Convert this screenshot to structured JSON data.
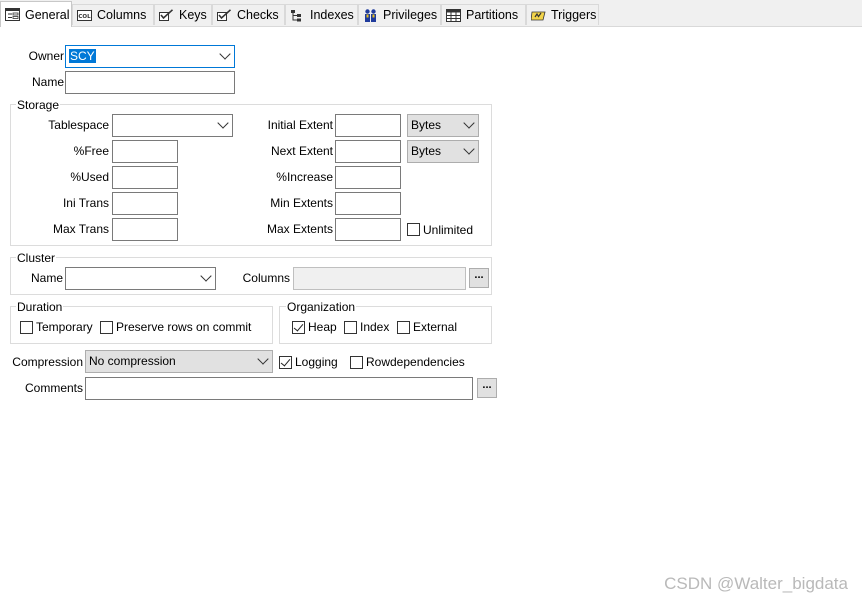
{
  "tabs": [
    {
      "label": "General",
      "icon": "general-form-icon",
      "active": true
    },
    {
      "label": "Columns",
      "icon": "columns-icon"
    },
    {
      "label": "Keys",
      "icon": "keys-icon"
    },
    {
      "label": "Checks",
      "icon": "checks-icon"
    },
    {
      "label": "Indexes",
      "icon": "indexes-icon"
    },
    {
      "label": "Privileges",
      "icon": "privileges-icon"
    },
    {
      "label": "Partitions",
      "icon": "partitions-icon"
    },
    {
      "label": "Triggers",
      "icon": "triggers-icon"
    }
  ],
  "owner": {
    "label": "Owner",
    "value": "SCY"
  },
  "name": {
    "label": "Name",
    "value": ""
  },
  "storage": {
    "title": "Storage",
    "tablespace_label": "Tablespace",
    "tablespace_value": "",
    "free_label": "%Free",
    "used_label": "%Used",
    "ini_trans_label": "Ini Trans",
    "max_trans_label": "Max Trans",
    "initial_extent_label": "Initial Extent",
    "initial_extent_unit": "Bytes",
    "next_extent_label": "Next Extent",
    "next_extent_unit": "Bytes",
    "increase_label": "%Increase",
    "min_extents_label": "Min Extents",
    "max_extents_label": "Max Extents",
    "unlimited_label": "Unlimited",
    "unlimited_checked": false
  },
  "cluster": {
    "title": "Cluster",
    "name_label": "Name",
    "columns_label": "Columns",
    "ellipsis": "..."
  },
  "duration": {
    "title": "Duration",
    "temporary_label": "Temporary",
    "preserve_label": "Preserve rows on commit"
  },
  "organization": {
    "title": "Organization",
    "heap_label": "Heap",
    "index_label": "Index",
    "external_label": "External"
  },
  "compression": {
    "label": "Compression",
    "value": "No compression"
  },
  "logging": {
    "label": "Logging",
    "checked": true
  },
  "rowdependencies": {
    "label": "Rowdependencies",
    "checked": false
  },
  "comments": {
    "label": "Comments",
    "value": "",
    "ellipsis": "..."
  },
  "watermark": "CSDN @Walter_bigdata"
}
